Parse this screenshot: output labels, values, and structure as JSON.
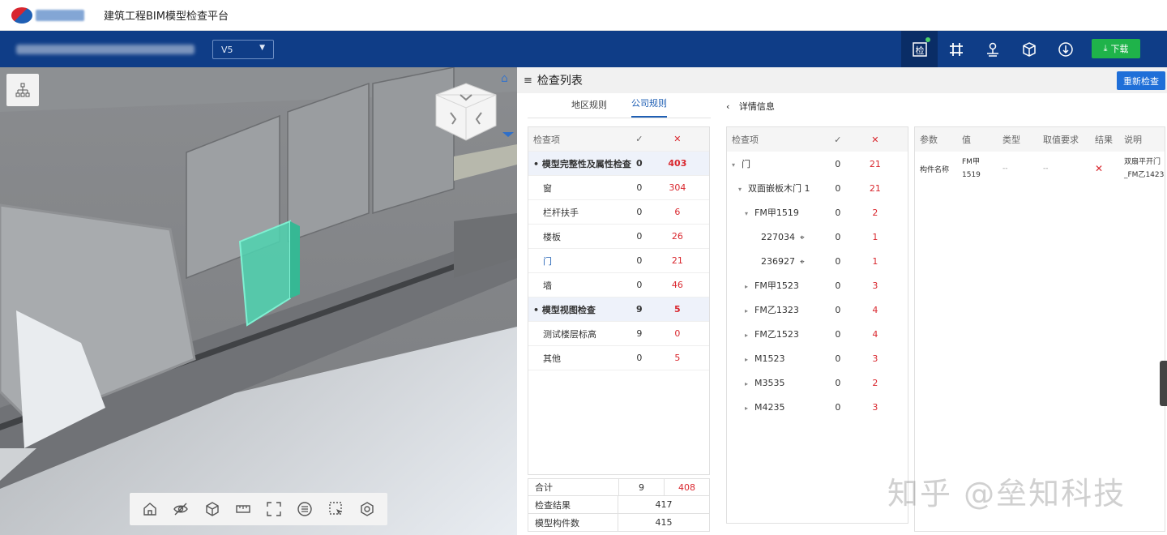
{
  "header": {
    "app_title": "建筑工程BIM模型检查平台"
  },
  "toolbar": {
    "version": "V5",
    "tools": [
      "check-icon",
      "grid-icon",
      "map-pin-icon",
      "cube-tag-icon",
      "anchor-icon"
    ],
    "download_label": "下载"
  },
  "panel": {
    "title": "检查列表",
    "recheck_label": "重新检查",
    "tabs": [
      {
        "label": "地区规则",
        "active": false
      },
      {
        "label": "公司规则",
        "active": true
      }
    ],
    "detail_label": "详情信息"
  },
  "check_table": {
    "headers": {
      "item": "检查项",
      "pass": "✓",
      "fail": "✕"
    },
    "rows": [
      {
        "name": "• 模型完整性及属性检查",
        "pass": "0",
        "fail": "403",
        "group": true
      },
      {
        "name": "窗",
        "pass": "0",
        "fail": "304"
      },
      {
        "name": "栏杆扶手",
        "pass": "0",
        "fail": "6"
      },
      {
        "name": "楼板",
        "pass": "0",
        "fail": "26"
      },
      {
        "name": "门",
        "pass": "0",
        "fail": "21",
        "selected": true
      },
      {
        "name": "墙",
        "pass": "0",
        "fail": "46"
      },
      {
        "name": "• 模型视图检查",
        "pass": "9",
        "fail": "5",
        "group": true
      },
      {
        "name": "测试楼层标高",
        "pass": "9",
        "fail": "0"
      },
      {
        "name": "其他",
        "pass": "0",
        "fail": "5"
      }
    ]
  },
  "summary": {
    "total_label": "合计",
    "total_pass": "9",
    "total_fail": "408",
    "result_label": "检查结果",
    "result_value": "417",
    "count_label": "模型构件数",
    "count_value": "415"
  },
  "detail_tree": {
    "headers": {
      "item": "检查项",
      "pass": "✓",
      "fail": "✕"
    },
    "rows": [
      {
        "name": "门",
        "level": 0,
        "arrow": "▾",
        "pass": "0",
        "fail": "21"
      },
      {
        "name": "双面嵌板木门 1",
        "level": 1,
        "arrow": "▾",
        "pass": "0",
        "fail": "21"
      },
      {
        "name": "FM甲1519",
        "level": 2,
        "arrow": "▾",
        "pass": "0",
        "fail": "2"
      },
      {
        "name": "227034",
        "level": 3,
        "arrow": "",
        "pass": "0",
        "fail": "1",
        "locate": true
      },
      {
        "name": "236927",
        "level": 3,
        "arrow": "",
        "pass": "0",
        "fail": "1",
        "locate": true
      },
      {
        "name": "FM甲1523",
        "level": 2,
        "arrow": "▸",
        "pass": "0",
        "fail": "3"
      },
      {
        "name": "FM乙1323",
        "level": 2,
        "arrow": "▸",
        "pass": "0",
        "fail": "4"
      },
      {
        "name": "FM乙1523",
        "level": 2,
        "arrow": "▸",
        "pass": "0",
        "fail": "4"
      },
      {
        "name": "M1523",
        "level": 2,
        "arrow": "▸",
        "pass": "0",
        "fail": "3"
      },
      {
        "name": "M3535",
        "level": 2,
        "arrow": "▸",
        "pass": "0",
        "fail": "2"
      },
      {
        "name": "M4235",
        "level": 2,
        "arrow": "▸",
        "pass": "0",
        "fail": "3"
      }
    ]
  },
  "param_table": {
    "headers": [
      "参数",
      "值",
      "类型",
      "取值要求",
      "结果",
      "说明"
    ],
    "row": {
      "param": "构件名称",
      "value_line1": "FM甲",
      "value_line2": "1519",
      "type": "--",
      "requirement": "--",
      "result": "✕",
      "note_line1": "双扇平开门",
      "note_line2": "_FM乙1423"
    }
  },
  "watermark": "知乎 @垒知科技"
}
